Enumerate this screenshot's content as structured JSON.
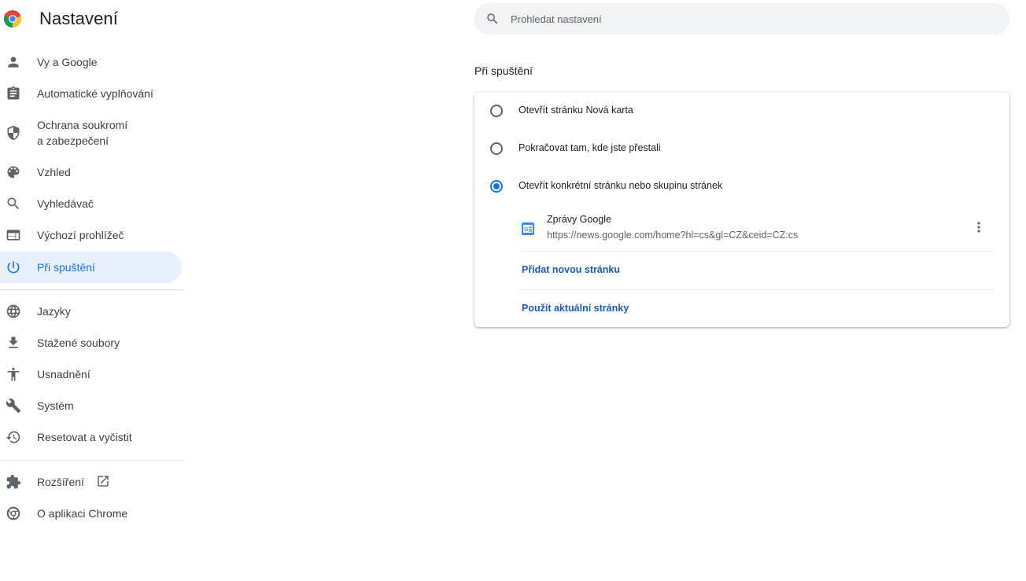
{
  "header": {
    "title": "Nastavení",
    "logo_icon": "chrome-logo-icon"
  },
  "search": {
    "placeholder": "Prohledat nastavení",
    "value": ""
  },
  "sidebar": {
    "items": [
      {
        "label": "Vy a Google",
        "icon": "person-icon"
      },
      {
        "label": "Automatické vyplňování",
        "icon": "clipboard-icon"
      },
      {
        "label": "Ochrana soukromí",
        "label2": "a zabezpečení",
        "icon": "shield-icon"
      },
      {
        "label": "Vzhled",
        "icon": "palette-icon"
      },
      {
        "label": "Vyhledávač",
        "icon": "search-icon"
      },
      {
        "label": "Výchozí prohlížeč",
        "icon": "browser-icon"
      },
      {
        "label": "Při spuštění",
        "icon": "power-icon",
        "active": true
      },
      {
        "label": "Jazyky",
        "icon": "globe-icon"
      },
      {
        "label": "Stažené soubory",
        "icon": "download-icon"
      },
      {
        "label": "Usnadnění",
        "icon": "accessibility-icon"
      },
      {
        "label": "Systém",
        "icon": "wrench-icon"
      },
      {
        "label": "Resetovat a vyčistit",
        "icon": "history-icon"
      },
      {
        "label": "Rozšíření",
        "icon": "puzzle-icon"
      },
      {
        "label": "O aplikaci Chrome",
        "icon": "chrome-icon"
      }
    ]
  },
  "main": {
    "section_title": "Při spuštění",
    "options": [
      {
        "label": "Otevřít stránku Nová karta",
        "checked": false
      },
      {
        "label": "Pokračovat tam, kde jste přestali",
        "checked": false
      },
      {
        "label": "Otevřít konkrétní stránku nebo skupinu stránek",
        "checked": true
      }
    ],
    "pages": [
      {
        "name": "Zprávy Google",
        "url": "https://news.google.com/home?hl=cs&gl=CZ&ceid=CZ:cs",
        "favicon": "google-news-icon"
      }
    ],
    "add_page_label": "Přidat novou stránku",
    "use_current_label": "Použít aktuální stránky"
  },
  "colors": {
    "accent": "#1a73e8",
    "active_bg": "#e8f0fe",
    "link": "#1a5ab8"
  }
}
